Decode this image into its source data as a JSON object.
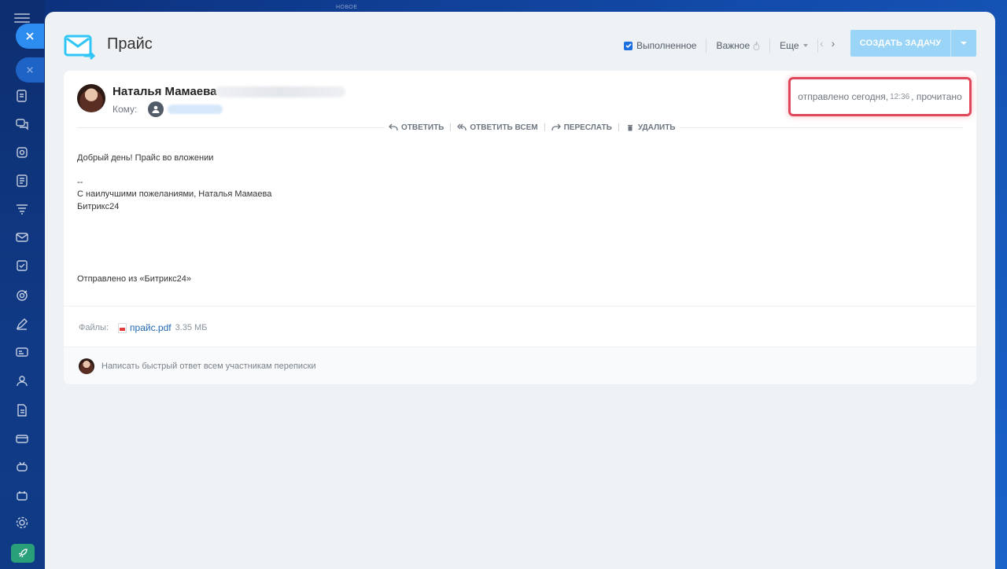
{
  "app": {
    "top_label": "НОВОЕ"
  },
  "header": {
    "title": "Прайс",
    "completed_label": "Выполненное",
    "completed_checked": true,
    "important_label": "Важное",
    "more_label": "Еще",
    "create_task_label": "СОЗДАТЬ ЗАДАЧУ",
    "accent_color": "#9ad4f7"
  },
  "message": {
    "sender_name": "Наталья Мамаева",
    "to_label": "Кому:",
    "sent_prefix": "отправлено сегодня,",
    "sent_time": "12:36",
    "sent_suffix": ", прочитано",
    "actions": [
      {
        "label": "ОТВЕТИТЬ",
        "icon": "reply-icon"
      },
      {
        "label": "ОТВЕТИТЬ ВСЕМ",
        "icon": "reply-all-icon"
      },
      {
        "label": "ПЕРЕСЛАТЬ",
        "icon": "forward-icon"
      },
      {
        "label": "УДАЛИТЬ",
        "icon": "trash-icon"
      }
    ],
    "body": {
      "greeting": "Добрый день! Прайс во вложении",
      "sig_dash": "--",
      "sig_line1": "С наилучшими пожеланиями, Наталья Мамаева",
      "sig_line2": "Битрикс24",
      "footer": "Отправлено из «Битрикс24»"
    },
    "files_label": "Файлы:",
    "file_name": "прайс.pdf",
    "file_size": "3.35 МБ",
    "quick_reply_placeholder": "Написать быстрый ответ всем участникам переписки",
    "highlight_color": "#e0475a"
  }
}
